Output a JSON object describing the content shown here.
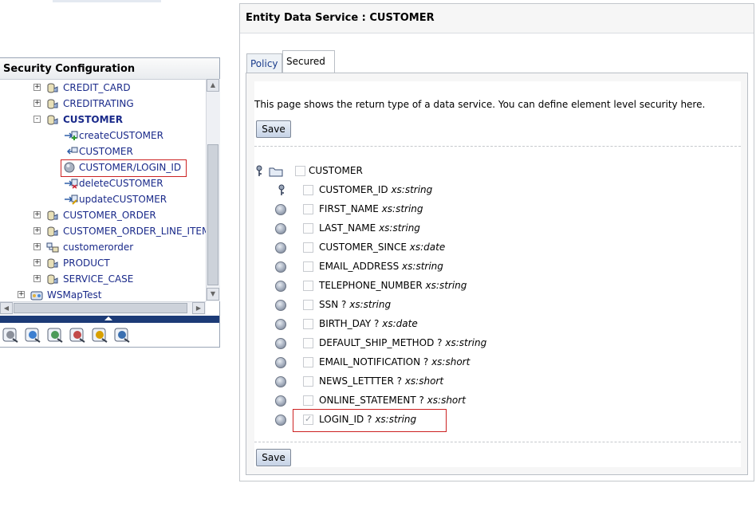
{
  "left": {
    "title": "Security Configuration",
    "tree": [
      {
        "label": "CREDIT_CARD",
        "level": 1,
        "expand": "+",
        "icon": "data-service-icon"
      },
      {
        "label": "CREDITRATING",
        "level": 1,
        "expand": "+",
        "icon": "data-service-icon"
      },
      {
        "label": "CUSTOMER",
        "level": 1,
        "expand": "-",
        "icon": "data-service-icon",
        "bold": true
      },
      {
        "label": "createCUSTOMER",
        "level": 2,
        "icon": "create-method-icon"
      },
      {
        "label": "CUSTOMER",
        "level": 2,
        "icon": "read-method-icon"
      },
      {
        "label": "CUSTOMER/LOGIN_ID",
        "level": 2,
        "icon": "element-ball-icon",
        "highlighted": true
      },
      {
        "label": "deleteCUSTOMER",
        "level": 2,
        "icon": "delete-method-icon"
      },
      {
        "label": "updateCUSTOMER",
        "level": 2,
        "icon": "update-method-icon"
      },
      {
        "label": "CUSTOMER_ORDER",
        "level": 1,
        "expand": "+",
        "icon": "data-service-icon"
      },
      {
        "label": "CUSTOMER_ORDER_LINE_ITEM",
        "level": 1,
        "expand": "+",
        "icon": "data-service-icon"
      },
      {
        "label": "customerorder",
        "level": 1,
        "expand": "+",
        "icon": "logical-service-icon"
      },
      {
        "label": "PRODUCT",
        "level": 1,
        "expand": "+",
        "icon": "data-service-icon"
      },
      {
        "label": "SERVICE_CASE",
        "level": 1,
        "expand": "+",
        "icon": "data-service-icon"
      },
      {
        "label": "WSMapTest",
        "level": 0,
        "expand": "+",
        "icon": "project-icon"
      }
    ],
    "toolbar_icons": [
      "tools-icon",
      "search-service-icon",
      "network-icon",
      "performance-gauge-icon",
      "security-config-icon",
      "key-policy-icon"
    ]
  },
  "right": {
    "header": "Entity Data Service : CUSTOMER",
    "tabs": [
      {
        "label": "Policy",
        "active": false
      },
      {
        "label": "Secured Elements",
        "active": true
      }
    ],
    "intro": "This page shows the return type of a data service. You can define element level security here.",
    "save_label": "Save",
    "root_label": "CUSTOMER",
    "elements": [
      {
        "name": "CUSTOMER_ID",
        "type": "xs:string",
        "key": true,
        "checked": false
      },
      {
        "name": "FIRST_NAME",
        "type": "xs:string",
        "checked": false
      },
      {
        "name": "LAST_NAME",
        "type": "xs:string",
        "checked": false
      },
      {
        "name": "CUSTOMER_SINCE",
        "type": "xs:date",
        "checked": false
      },
      {
        "name": "EMAIL_ADDRESS",
        "type": "xs:string",
        "checked": false
      },
      {
        "name": "TELEPHONE_NUMBER",
        "type": "xs:string",
        "checked": false
      },
      {
        "name": "SSN ?",
        "type": "xs:string",
        "checked": false
      },
      {
        "name": "BIRTH_DAY ?",
        "type": "xs:date",
        "checked": false
      },
      {
        "name": "DEFAULT_SHIP_METHOD ?",
        "type": "xs:string",
        "checked": false
      },
      {
        "name": "EMAIL_NOTIFICATION ?",
        "type": "xs:short",
        "checked": false
      },
      {
        "name": "NEWS_LETTTER ?",
        "type": "xs:short",
        "checked": false
      },
      {
        "name": "ONLINE_STATEMENT ?",
        "type": "xs:short",
        "checked": false
      },
      {
        "name": "LOGIN_ID ?",
        "type": "xs:string",
        "checked": true,
        "highlighted": true
      }
    ]
  }
}
